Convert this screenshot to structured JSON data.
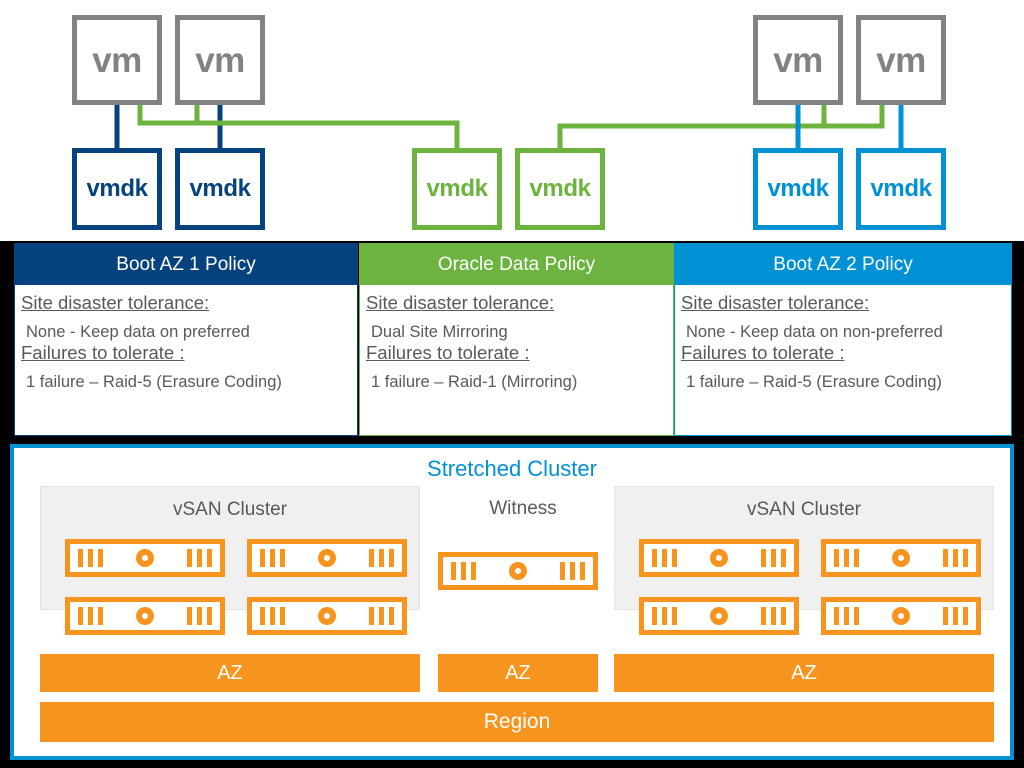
{
  "colors": {
    "dark_blue": "#06437e",
    "green": "#6cb33f",
    "light_blue": "#0091d5",
    "orange": "#f7941e",
    "gray": "#808285",
    "text_gray": "#58595b"
  },
  "vms": [
    {
      "label": "vm"
    },
    {
      "label": "vm"
    },
    {
      "label": "vm"
    },
    {
      "label": "vm"
    }
  ],
  "vmdks": [
    {
      "label": "vmdk",
      "color": "dark_blue"
    },
    {
      "label": "vmdk",
      "color": "dark_blue"
    },
    {
      "label": "vmdk",
      "color": "green"
    },
    {
      "label": "vmdk",
      "color": "green"
    },
    {
      "label": "vmdk",
      "color": "light_blue"
    },
    {
      "label": "vmdk",
      "color": "light_blue"
    }
  ],
  "policies": [
    {
      "title": "Boot AZ 1 Policy",
      "sdt_label": "Site disaster tolerance:",
      "sdt_value": "None - Keep data on preferred",
      "ftt_label": "Failures to tolerate :",
      "ftt_value": "1 failure – Raid-5 (Erasure Coding)",
      "accent": "#06437e"
    },
    {
      "title": "Oracle Data Policy",
      "sdt_label": "Site disaster tolerance:",
      "sdt_value": "Dual Site Mirroring",
      "ftt_label": "Failures to tolerate :",
      "ftt_value": "1 failure – Raid-1 (Mirroring)",
      "accent": "#6cb33f"
    },
    {
      "title": "Boot AZ 2 Policy",
      "sdt_label": "Site disaster tolerance:",
      "sdt_value": "None - Keep data on non-preferred",
      "ftt_label": "Failures to tolerate :",
      "ftt_value": "1 failure – Raid-5 (Erasure Coding)",
      "accent": "#0091d5"
    }
  ],
  "stretched_cluster": {
    "title": "Stretched Cluster",
    "cluster_left_label": "vSAN Cluster",
    "witness_label": "Witness",
    "cluster_right_label": "vSAN Cluster",
    "az_left_label": "AZ",
    "az_mid_label": "AZ",
    "az_right_label": "AZ",
    "region_label": "Region",
    "server_icon_name": "server-icon",
    "left_cluster_servers": 4,
    "witness_servers": 1,
    "right_cluster_servers": 4
  }
}
